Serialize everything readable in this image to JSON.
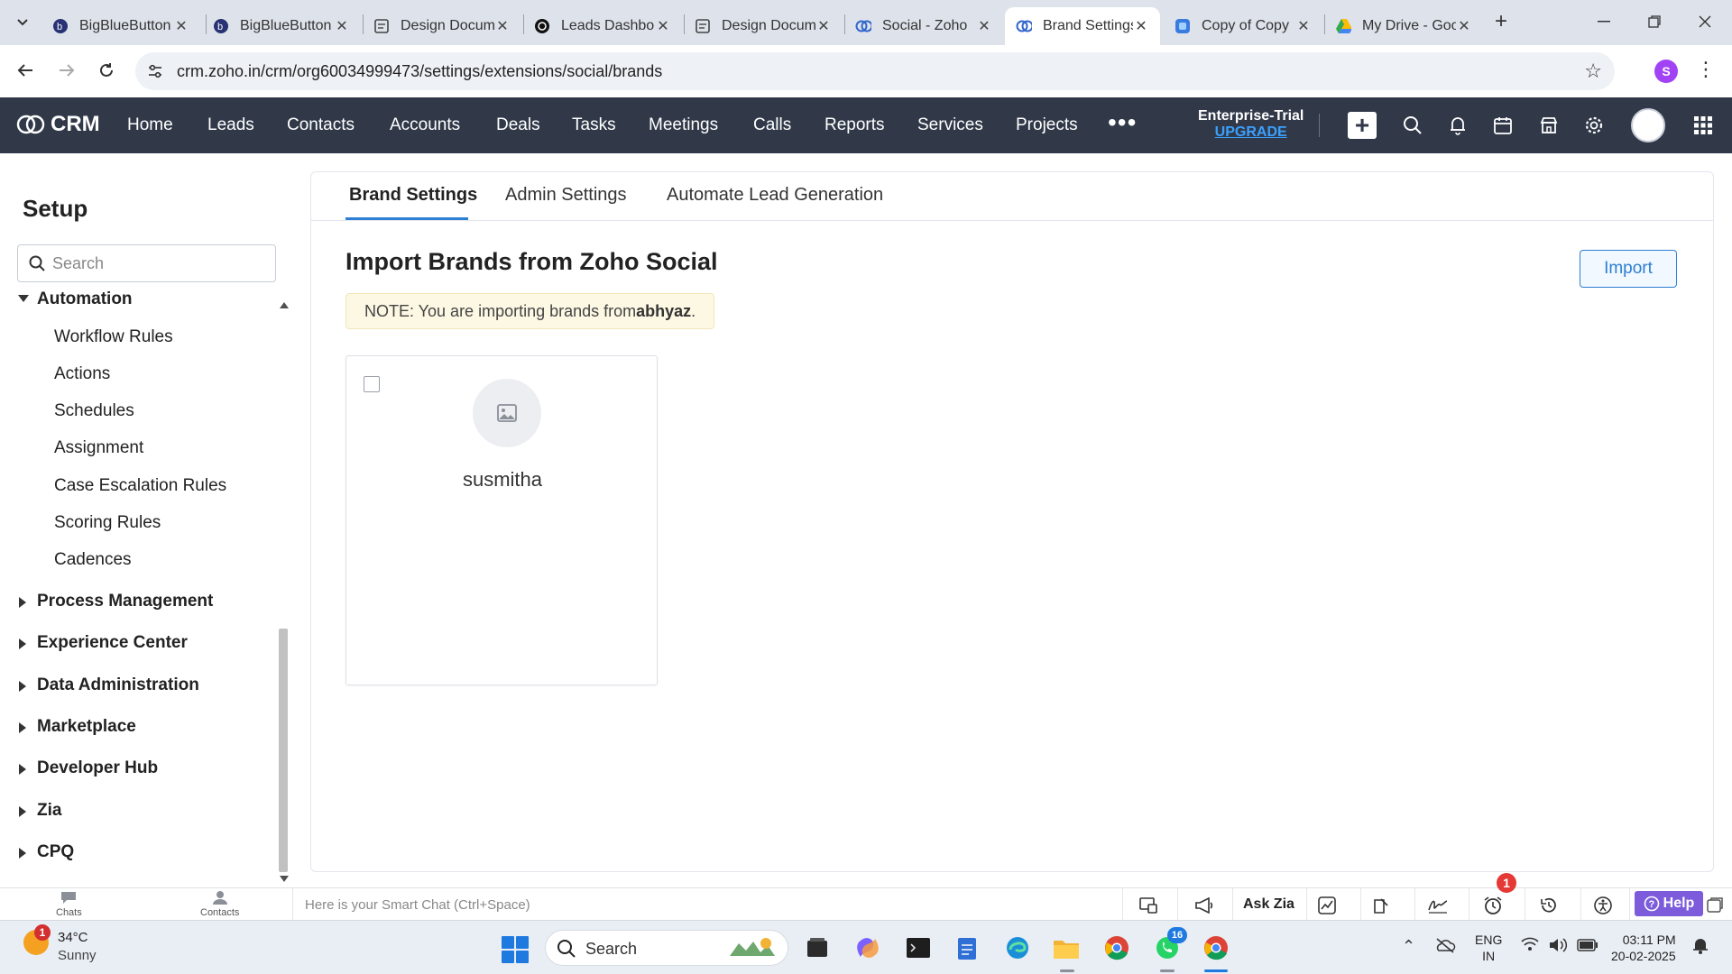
{
  "browser": {
    "tabs": [
      {
        "title": "BigBlueButton",
        "icon": "bigbluebutton-icon"
      },
      {
        "title": "BigBlueButton",
        "icon": "bigbluebutton-icon"
      },
      {
        "title": "Design Document",
        "icon": "docs-icon"
      },
      {
        "title": "Leads Dashboard",
        "icon": "openai-icon"
      },
      {
        "title": "Design Document",
        "icon": "docs-icon"
      },
      {
        "title": "Social - Zoho",
        "icon": "zoho-crm-icon"
      },
      {
        "title": "Brand Settings",
        "icon": "zoho-crm-icon",
        "active": true
      },
      {
        "title": "Copy of Copy",
        "icon": "canva-icon"
      },
      {
        "title": "My Drive - Google Drive",
        "icon": "google-drive-icon"
      }
    ],
    "url": "crm.zoho.in/crm/org60034999473/settings/extensions/social/brands",
    "profile_initial": "S"
  },
  "crm_nav": {
    "logo": "CRM",
    "items": [
      "Home",
      "Leads",
      "Contacts",
      "Accounts",
      "Deals",
      "Tasks",
      "Meetings",
      "Calls",
      "Reports",
      "Services",
      "Projects"
    ],
    "more_label": "•••",
    "plan_label": "Enterprise-Trial",
    "upgrade_label": "UPGRADE"
  },
  "sidebar": {
    "title": "Setup",
    "search_placeholder": "Search",
    "expanded_section": "Automation",
    "automation_items": [
      "Workflow Rules",
      "Actions",
      "Schedules",
      "Assignment",
      "Case Escalation Rules",
      "Scoring Rules",
      "Cadences"
    ],
    "collapsed_sections": [
      "Process Management",
      "Experience Center",
      "Data Administration",
      "Marketplace",
      "Developer Hub",
      "Zia",
      "CPQ"
    ]
  },
  "main": {
    "tabs": [
      "Brand Settings",
      "Admin Settings",
      "Automate Lead Generation"
    ],
    "active_tab": "Brand Settings",
    "title": "Import Brands from Zoho Social",
    "import_label": "Import",
    "note_prefix": "NOTE: You are importing brands from ",
    "note_org": "abhyaz",
    "note_suffix": ".",
    "brands": [
      {
        "name": "susmitha",
        "selected": false
      }
    ]
  },
  "crm_bottom": {
    "chats_label": "Chats",
    "contacts_label": "Contacts",
    "smart_chat_placeholder": "Here is your Smart Chat (Ctrl+Space)",
    "ask_zia_label": "Ask Zia",
    "alarm_badge": "1",
    "help_label": "Help"
  },
  "taskbar": {
    "weather_temp": "34°C",
    "weather_condition": "Sunny",
    "weather_badge": "1",
    "search_label": "Search",
    "whatsapp_badge": "16",
    "lang_line1": "ENG",
    "lang_line2": "IN",
    "time": "03:11 PM",
    "date": "20-02-2025"
  },
  "colors": {
    "nav_bg": "#313949",
    "accent": "#2d7fd3",
    "note_bg": "#fdf8e3",
    "help_bg": "#7c5cdb"
  }
}
